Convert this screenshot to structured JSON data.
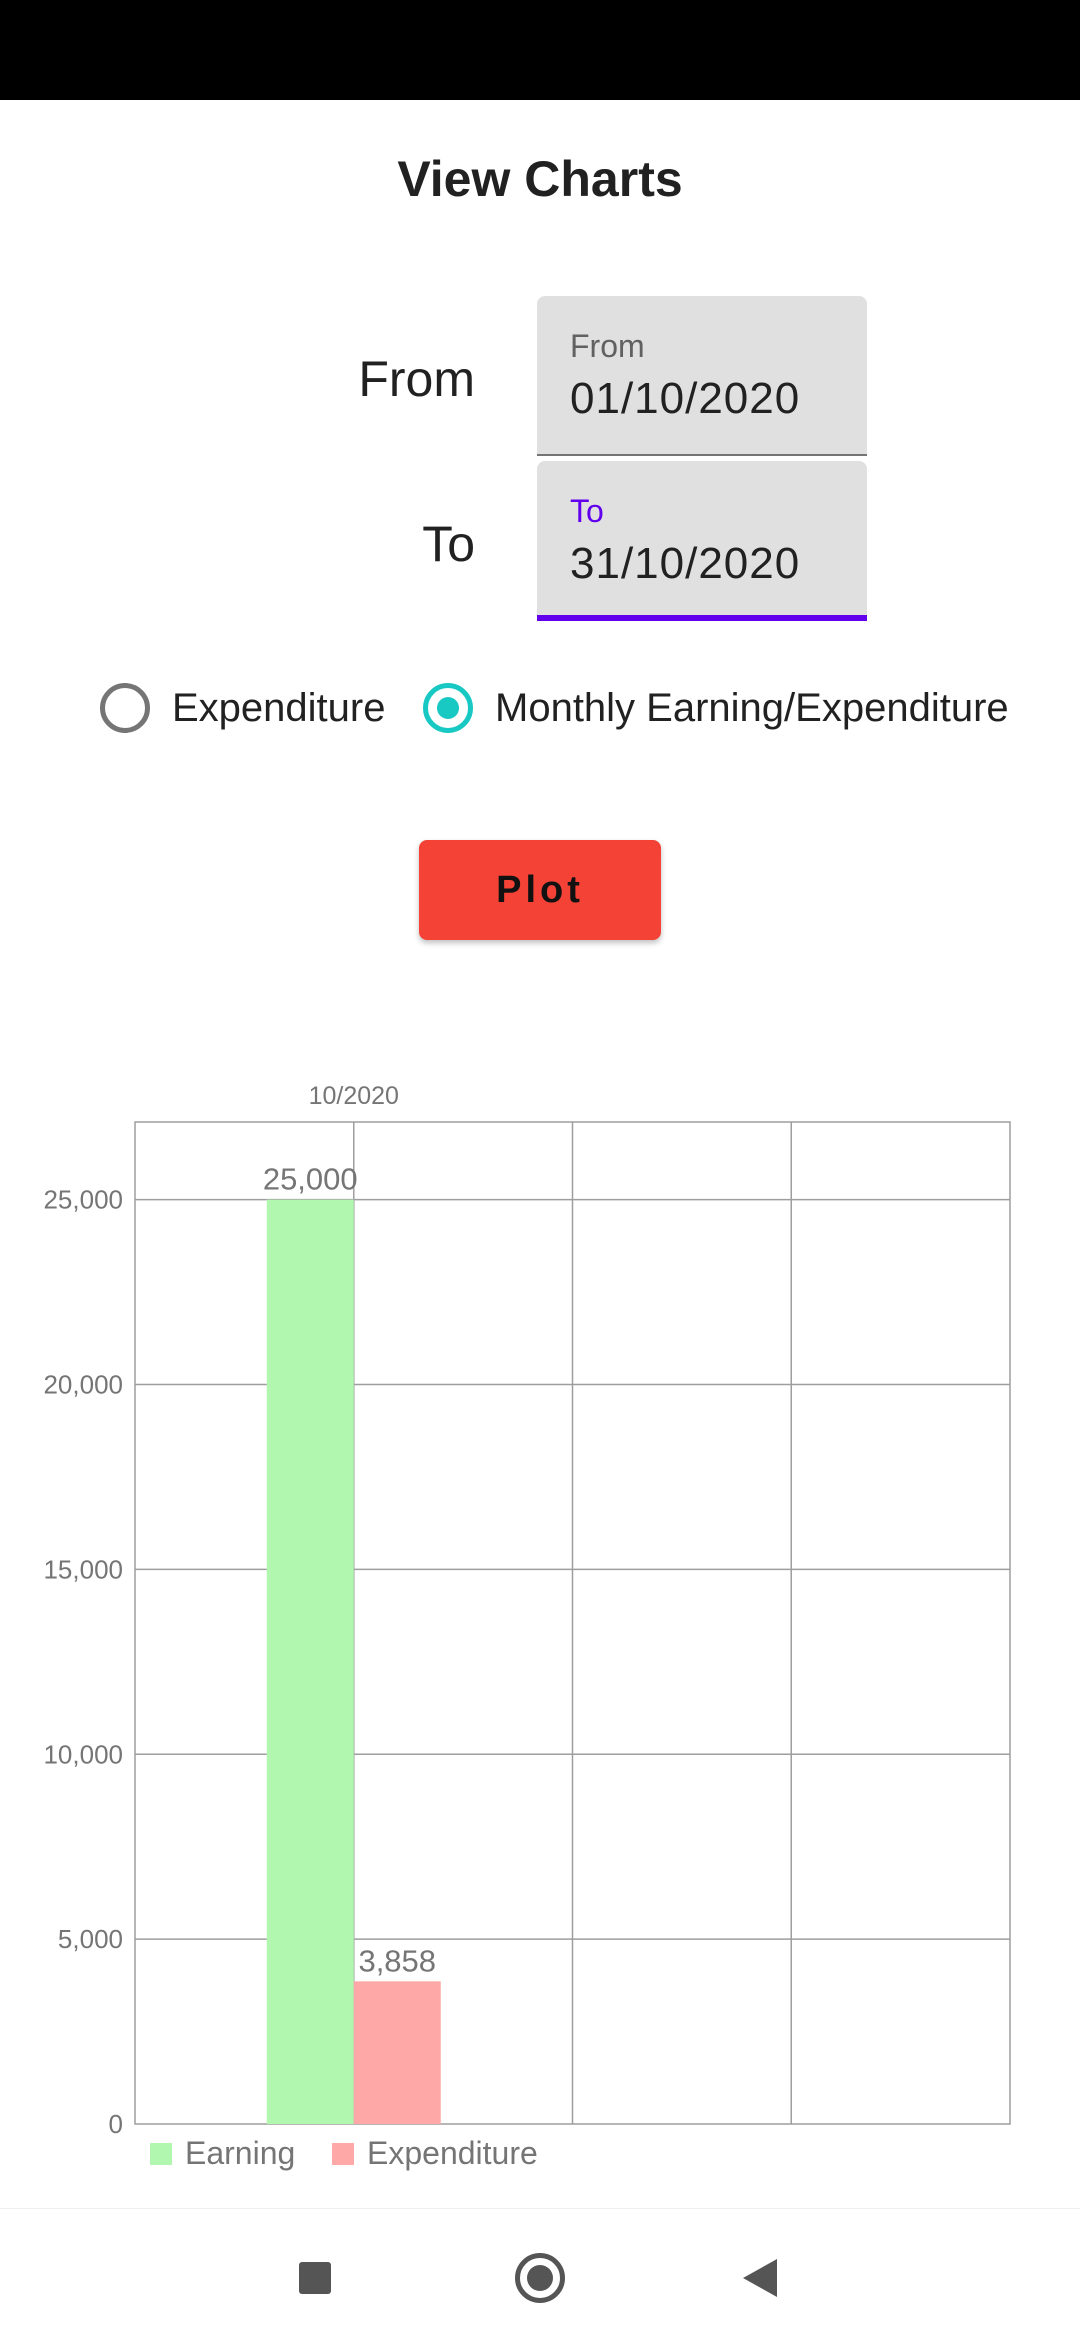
{
  "page": {
    "title": "View Charts"
  },
  "date_range": {
    "from_label": "From",
    "from_field_label": "From",
    "from_value": "01/10/2020",
    "to_label": "To",
    "to_field_label": "To",
    "to_value": "31/10/2020",
    "accent_color": "#6200ee"
  },
  "chart_mode": {
    "options": [
      {
        "label": "Expenditure",
        "checked": false
      },
      {
        "label": "Monthly Earning/Expenditure",
        "checked": true
      }
    ],
    "checked_color": "#18c8c3"
  },
  "plot_button": {
    "label": "Plot",
    "color": "#f44336"
  },
  "chart_data": {
    "type": "bar",
    "categories": [
      "10/2020"
    ],
    "series": [
      {
        "name": "Earning",
        "values": [
          25000
        ],
        "color": "#b2f7b0"
      },
      {
        "name": "Expenditure",
        "values": [
          3858
        ],
        "color": "#ffa8a8"
      }
    ],
    "data_labels": [
      "25,000",
      "3,858"
    ],
    "y_ticks": [
      0,
      5000,
      10000,
      15000,
      20000,
      25000
    ],
    "y_tick_labels": [
      "0",
      "5,000",
      "10,000",
      "15,000",
      "20,000",
      "25,000"
    ],
    "ylim": [
      0,
      27100
    ],
    "grid": true,
    "legend": "bottom-left"
  },
  "nav_bar": {
    "icons": [
      "recents-square-icon",
      "home-circle-icon",
      "back-triangle-icon"
    ]
  }
}
